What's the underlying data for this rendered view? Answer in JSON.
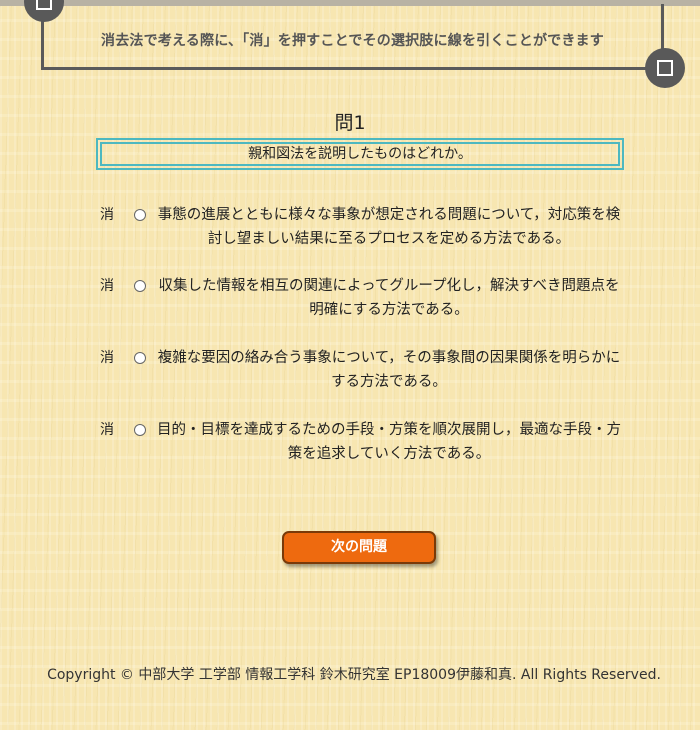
{
  "notice": {
    "text": "消去法で考える際に、「消」を押すことでその選択肢に線を引くことができます"
  },
  "question": {
    "number": "問1",
    "text": "親和図法を説明したものはどれか。"
  },
  "choices": [
    {
      "strike_label": "消",
      "text": "事態の進展とともに様々な事象が想定される問題について，対応策を検討し望ましい結果に至るプロセスを定める方法である。"
    },
    {
      "strike_label": "消",
      "text": "収集した情報を相互の関連によってグループ化し，解決すべき問題点を明確にする方法である。"
    },
    {
      "strike_label": "消",
      "text": "複雑な要因の絡み合う事象について，その事象間の因果関係を明らかにする方法である。"
    },
    {
      "strike_label": "消",
      "text": "目的・目標を達成するための手段・方策を順次展開し，最適な手段・方策を追求していく方法である。"
    }
  ],
  "next_button": {
    "label": "次の問題"
  },
  "footer": {
    "copyright": "Copyright © 中部大学 工学部 情報工学科 鈴木研究室 EP18009伊藤和真. All Rights Reserved."
  },
  "colors": {
    "background": "#f7e6b1",
    "accent_button": "#ee6a0f",
    "question_border": "#4db8c0",
    "frame": "#5a5a5a"
  },
  "icons": {
    "corner_top_left": "square-icon",
    "corner_bottom_right": "square-icon",
    "choice_selector": "radio-icon"
  }
}
